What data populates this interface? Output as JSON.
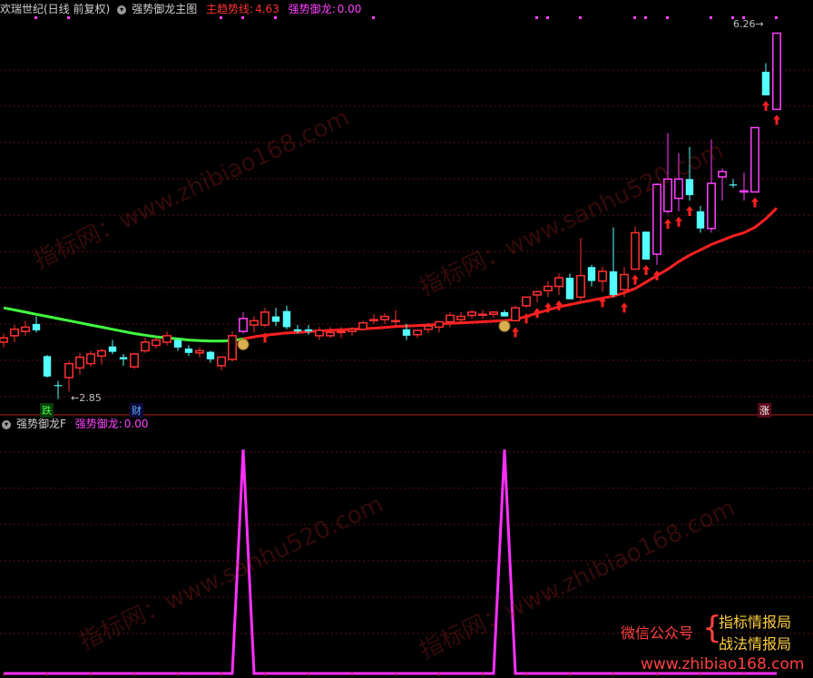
{
  "header_main": {
    "stock": "欢瑞世纪(日线 前复权)",
    "indicator": "强势御龙主图",
    "trend_label": "主趋势线:",
    "trend_value": "4.63",
    "signal_label": "强势御龙:",
    "signal_value": "0.00"
  },
  "header_sub": {
    "indicator": "强势御龙F",
    "signal_label": "强势御龙:",
    "signal_value": "0.00"
  },
  "markers": {
    "low_label": "2.85",
    "high_label": "6.26",
    "tag_die": "跌",
    "tag_cai": "财",
    "tag_zhang": "涨"
  },
  "watermarks": [
    "指标网：www.zhibiao168.com",
    "指标网：www.sanhu520.com",
    "指标网：www.sanhu520.com",
    "指标网：www.zhibiao168.com"
  ],
  "promo": {
    "left": "微信公众号",
    "right1": "指标情报局",
    "right2": "战法情报局",
    "url": "www.zhibiao168.com"
  },
  "colors": {
    "up": "#ff3030",
    "down": "#54ffff",
    "strong": "#ff40ff",
    "trend_red": "#ff2020",
    "trend_green": "#40ff40",
    "osc": "#ff30ff"
  },
  "chart_data": [
    {
      "type": "candlestick",
      "title": "欢瑞世纪(日线 前复权)",
      "series": [
        {
          "name": "K线",
          "ohlc": [
            [
              3.38,
              3.46,
              3.33,
              3.42
            ],
            [
              3.44,
              3.54,
              3.38,
              3.5
            ],
            [
              3.48,
              3.58,
              3.44,
              3.52
            ],
            [
              3.55,
              3.62,
              3.47,
              3.49
            ],
            [
              3.25,
              3.26,
              3.05,
              3.06
            ],
            [
              2.98,
              3.02,
              2.85,
              2.97
            ],
            [
              3.05,
              3.2,
              2.92,
              3.18
            ],
            [
              3.14,
              3.28,
              3.08,
              3.24
            ],
            [
              3.18,
              3.3,
              3.15,
              3.27
            ],
            [
              3.25,
              3.32,
              3.17,
              3.3
            ],
            [
              3.34,
              3.4,
              3.27,
              3.29
            ],
            [
              3.24,
              3.27,
              3.16,
              3.22
            ],
            [
              3.15,
              3.28,
              3.13,
              3.27
            ],
            [
              3.3,
              3.42,
              3.28,
              3.38
            ],
            [
              3.35,
              3.42,
              3.32,
              3.4
            ],
            [
              3.38,
              3.48,
              3.35,
              3.44
            ],
            [
              3.4,
              3.42,
              3.3,
              3.33
            ],
            [
              3.32,
              3.35,
              3.25,
              3.28
            ],
            [
              3.28,
              3.33,
              3.24,
              3.3
            ],
            [
              3.29,
              3.3,
              3.19,
              3.22
            ],
            [
              3.16,
              3.25,
              3.12,
              3.24
            ],
            [
              3.22,
              3.48,
              3.2,
              3.44
            ],
            [
              3.48,
              3.66,
              3.46,
              3.6
            ],
            [
              3.54,
              3.62,
              3.47,
              3.58
            ],
            [
              3.54,
              3.7,
              3.52,
              3.66
            ],
            [
              3.62,
              3.7,
              3.53,
              3.57
            ],
            [
              3.67,
              3.72,
              3.5,
              3.52
            ],
            [
              3.5,
              3.54,
              3.46,
              3.48
            ],
            [
              3.5,
              3.54,
              3.45,
              3.48
            ],
            [
              3.44,
              3.52,
              3.4,
              3.49
            ],
            [
              3.44,
              3.52,
              3.42,
              3.47
            ],
            [
              3.47,
              3.52,
              3.42,
              3.48
            ],
            [
              3.48,
              3.52,
              3.44,
              3.5
            ],
            [
              3.5,
              3.58,
              3.49,
              3.56
            ],
            [
              3.58,
              3.64,
              3.55,
              3.59
            ],
            [
              3.59,
              3.65,
              3.55,
              3.62
            ],
            [
              3.58,
              3.68,
              3.53,
              3.58
            ],
            [
              3.5,
              3.55,
              3.4,
              3.44
            ],
            [
              3.45,
              3.5,
              3.42,
              3.49
            ],
            [
              3.5,
              3.56,
              3.46,
              3.53
            ],
            [
              3.52,
              3.58,
              3.47,
              3.57
            ],
            [
              3.57,
              3.66,
              3.52,
              3.63
            ],
            [
              3.59,
              3.66,
              3.56,
              3.62
            ],
            [
              3.63,
              3.68,
              3.6,
              3.66
            ],
            [
              3.64,
              3.68,
              3.6,
              3.64
            ],
            [
              3.64,
              3.67,
              3.61,
              3.66
            ],
            [
              3.66,
              3.68,
              3.62,
              3.62
            ],
            [
              3.58,
              3.72,
              3.57,
              3.7
            ],
            [
              3.72,
              3.8,
              3.7,
              3.8
            ],
            [
              3.82,
              3.86,
              3.75,
              3.85
            ],
            [
              3.86,
              3.95,
              3.8,
              3.9
            ],
            [
              3.9,
              4.02,
              3.82,
              3.98
            ],
            [
              3.98,
              4.02,
              3.78,
              3.78
            ],
            [
              3.8,
              4.35,
              3.75,
              4.0
            ],
            [
              4.08,
              4.1,
              3.9,
              3.95
            ],
            [
              3.95,
              4.08,
              3.85,
              4.04
            ],
            [
              4.04,
              4.45,
              3.8,
              3.82
            ],
            [
              3.87,
              4.08,
              3.8,
              4.01
            ],
            [
              4.06,
              4.46,
              4.06,
              4.4
            ],
            [
              4.41,
              4.41,
              4.15,
              4.15
            ],
            [
              4.2,
              4.86,
              4.1,
              4.85
            ],
            [
              4.6,
              5.33,
              4.58,
              4.9
            ],
            [
              4.72,
              5.14,
              4.6,
              4.9
            ],
            [
              4.9,
              5.2,
              4.7,
              4.75
            ],
            [
              4.6,
              4.65,
              4.4,
              4.44
            ],
            [
              4.44,
              5.27,
              4.4,
              4.86
            ],
            [
              4.92,
              5.0,
              4.7,
              4.97
            ],
            [
              4.85,
              4.9,
              4.82,
              4.84
            ],
            [
              4.78,
              4.96,
              4.7,
              4.79
            ],
            [
              4.78,
              5.38,
              4.78,
              5.38
            ],
            [
              5.9,
              5.98,
              5.68,
              5.68
            ],
            [
              5.55,
              6.26,
              5.55,
              6.26
            ]
          ]
        },
        {
          "name": "主趋势线",
          "values": [
            3.7,
            3.68,
            3.66,
            3.64,
            3.62,
            3.6,
            3.58,
            3.56,
            3.54,
            3.52,
            3.5,
            3.48,
            3.46,
            3.445,
            3.43,
            3.42,
            3.41,
            3.4,
            3.395,
            3.39,
            3.39,
            3.395,
            3.41,
            3.43,
            3.445,
            3.455,
            3.465,
            3.47,
            3.478,
            3.485,
            3.49,
            3.495,
            3.5,
            3.505,
            3.51,
            3.518,
            3.525,
            3.53,
            3.535,
            3.54,
            3.548,
            3.555,
            3.56,
            3.565,
            3.57,
            3.575,
            3.58,
            3.59,
            3.62,
            3.65,
            3.68,
            3.71,
            3.73,
            3.75,
            3.77,
            3.79,
            3.81,
            3.84,
            3.88,
            3.94,
            4.0,
            4.06,
            4.13,
            4.19,
            4.24,
            4.29,
            4.33,
            4.37,
            4.4,
            4.45,
            4.53,
            4.63
          ]
        }
      ],
      "ylim": [
        2.72,
        6.4
      ]
    },
    {
      "type": "line",
      "title": "强势御龙F",
      "series": [
        {
          "name": "强势御龙",
          "values": [
            0,
            0,
            0,
            0,
            0,
            0,
            0,
            0,
            0,
            0,
            0,
            0,
            0,
            0,
            0,
            0,
            0,
            0,
            0,
            0,
            0,
            0,
            1,
            0,
            0,
            0,
            0,
            0,
            0,
            0,
            0,
            0,
            0,
            0,
            0,
            0,
            0,
            0,
            0,
            0,
            0,
            0,
            0,
            0,
            0,
            0,
            1,
            0,
            0,
            0,
            0,
            0,
            0,
            0,
            0,
            0,
            0,
            0,
            0,
            0,
            0,
            0,
            0,
            0,
            0,
            0,
            0,
            0,
            0,
            0,
            0,
            0
          ]
        }
      ],
      "ylim": [
        0,
        1.07
      ]
    }
  ]
}
